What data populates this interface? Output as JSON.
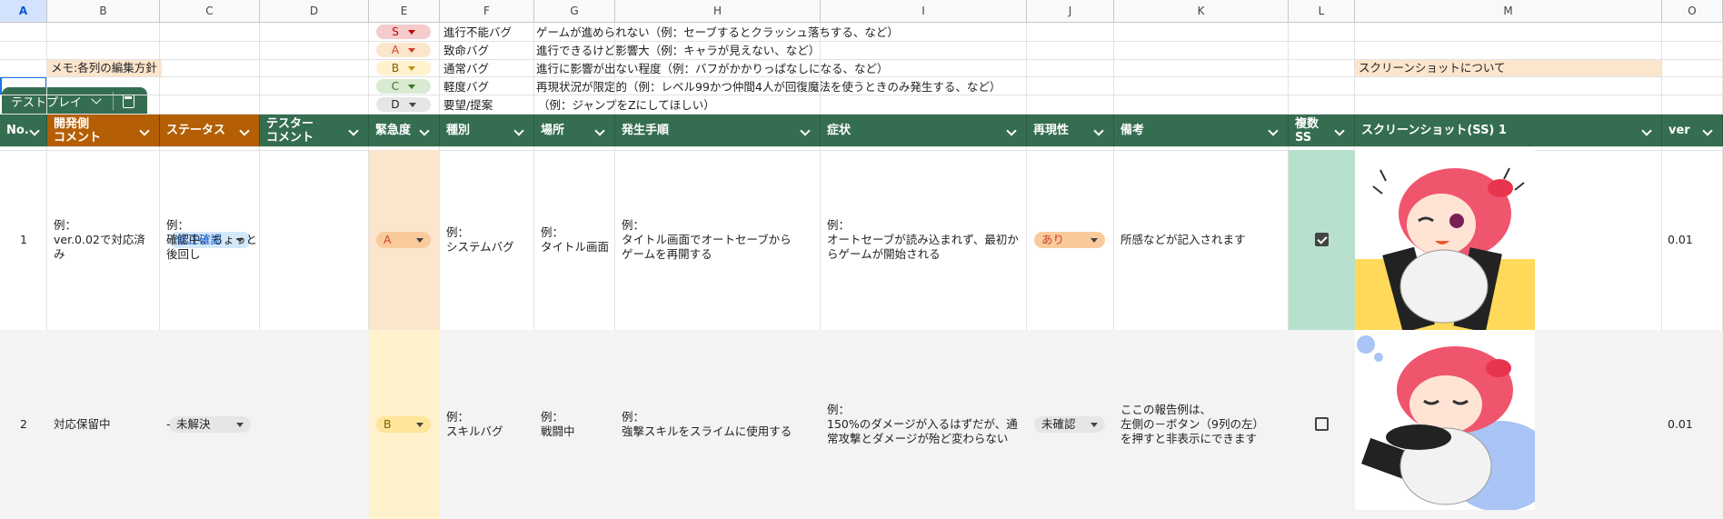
{
  "columns": [
    "A",
    "B",
    "C",
    "D",
    "E",
    "F",
    "G",
    "H",
    "I",
    "J",
    "K",
    "L",
    "M",
    "O"
  ],
  "legend": [
    {
      "level": "S",
      "label": "進行不能バグ",
      "desc": "ゲームが進められない（例：セーブするとクラッシュ落ちする、など）",
      "bg": "#f4cccc"
    },
    {
      "level": "A",
      "label": "致命バグ",
      "desc": "進行できるけど影響大（例：キャラが見えない、など）",
      "bg": "#fce5cd"
    },
    {
      "level": "B",
      "label": "通常バグ",
      "desc": "進行に影響が出ない程度（例：バフがかかりっぱなしになる、など）",
      "bg": "#fff2cc"
    },
    {
      "level": "C",
      "label": "軽度バグ",
      "desc": "再現状況が限定的（例：レベル99かつ仲間4人が回復魔法を使うときのみ発生する、など）",
      "bg": "#d9ead3"
    },
    {
      "level": "D",
      "label": "要望/提案",
      "desc": "（例：ジャンプをZにしてほしい）",
      "bg": "#e6e6e6"
    }
  ],
  "memo_label": "メモ:各列の編集方針",
  "screenshot_note": "スクリーンショットについて",
  "sheet_tab": {
    "name": "テストプレイ"
  },
  "headers": {
    "no": "No.",
    "dev": "開発側\nコメント",
    "status": "ステータス",
    "tester": "テスター\nコメント",
    "urgency": "緊急度",
    "kind": "種別",
    "place": "場所",
    "steps": "発生手順",
    "symptom": "症状",
    "repro": "再現性",
    "notes": "備考",
    "multi": "複数\nSS",
    "ss1": "スクリーンショット(SS) 1",
    "ver": "ver"
  },
  "rows": [
    {
      "no": "1",
      "dev": "例：\nver.0.02で対応済み",
      "status": "修正確認",
      "tester": "例：\n確認中。ちょっと後回し",
      "urgency": "A",
      "kind": "例：\nシステムバグ",
      "place": "例：\nタイトル画面",
      "steps": "例：\nタイトル画面でオートセーブから\nゲームを再開する",
      "symptom": "例：\nオートセーブが読み込まれず、最初からゲームが開始される",
      "repro": "あり",
      "notes": "所感などが記入されます",
      "multi": true,
      "ver": "0.01"
    },
    {
      "no": "2",
      "dev": "対応保留中",
      "status": "未解決",
      "tester": "-",
      "urgency": "B",
      "kind": "例：\nスキルバグ",
      "place": "例：\n戦闘中",
      "steps": "例：\n強撃スキルをスライムに使用する",
      "symptom": "例：\n150%のダメージが入るはずだが、通常攻撃とダメージが殆ど変わらない",
      "repro": "未確認",
      "notes": "ここの報告例は、\n左側の－ボタン（9列の左）\nを押すと非表示にできます",
      "multi": false,
      "ver": "0.01"
    }
  ]
}
